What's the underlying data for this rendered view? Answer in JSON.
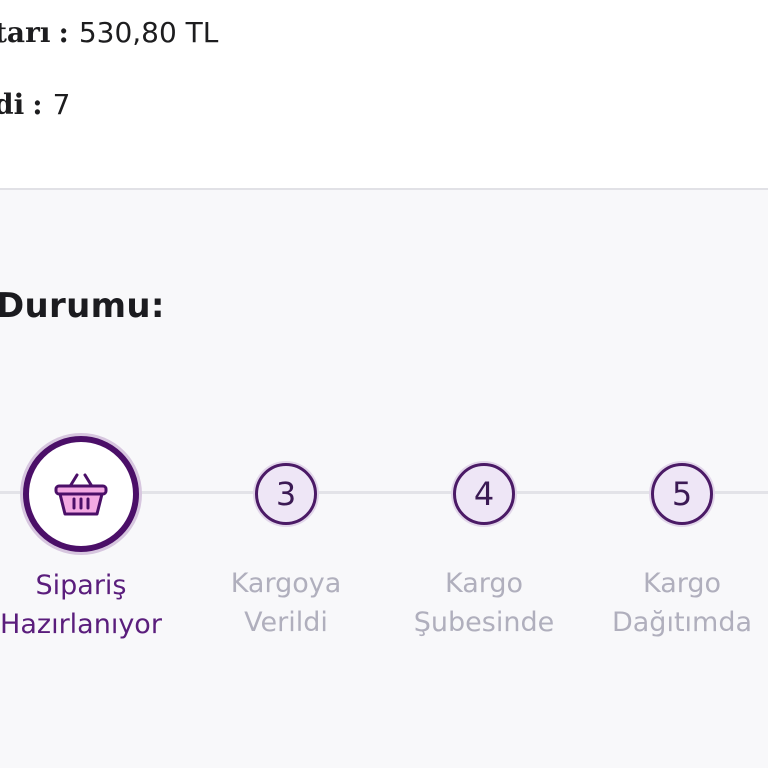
{
  "summary": {
    "amount_label": "tarı",
    "amount_separator": ":",
    "amount_value": "530,80 TL",
    "count_label": "di",
    "count_separator": ":",
    "count_value": "7"
  },
  "status": {
    "title": "Durumu:",
    "steps": [
      {
        "number": "",
        "icon": "basket-icon",
        "line1": "Sipariş",
        "line2": "Hazırlanıyor",
        "state": "active"
      },
      {
        "number": "3",
        "icon": "",
        "line1": "Kargoya",
        "line2": "Verildi",
        "state": "pending"
      },
      {
        "number": "4",
        "icon": "",
        "line1": "Kargo",
        "line2": "Şubesinde",
        "state": "pending"
      },
      {
        "number": "5",
        "icon": "",
        "line1": "Kargo",
        "line2": "Dağıtımda",
        "state": "pending"
      }
    ]
  },
  "colors": {
    "accent": "#4b0f68",
    "active_label": "#5a1d7c",
    "inactive_label": "#b0afbd",
    "basket_fill": "#f3a9e3",
    "panel_background": "#f8f8fa"
  }
}
